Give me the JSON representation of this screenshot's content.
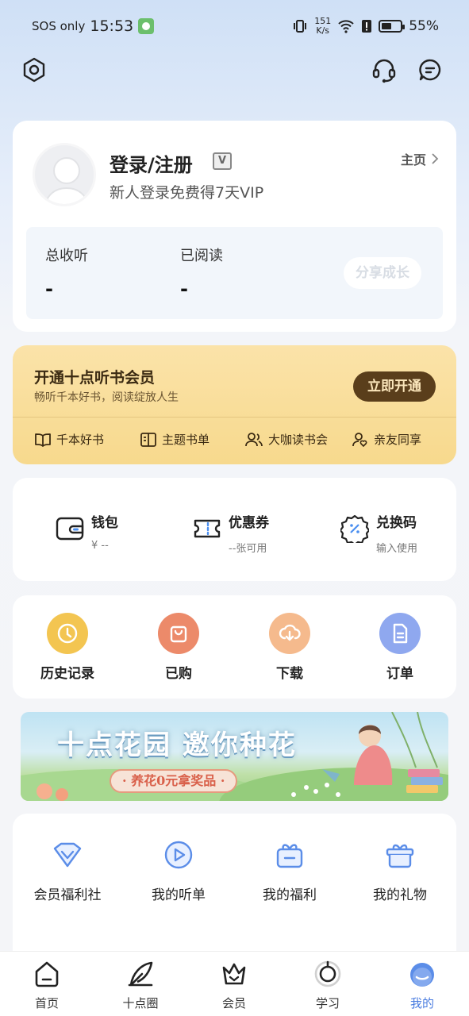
{
  "status_bar": {
    "carrier": "SOS only",
    "time": "15:53",
    "net_speed_value": "151",
    "net_speed_unit": "K/s",
    "battery": "55%"
  },
  "top_bar": {
    "icons": [
      "settings-icon",
      "customer-service-icon",
      "message-icon"
    ]
  },
  "profile": {
    "login_label": "登录/注册",
    "vip_badge": "V",
    "subtitle": "新人登录免费得7天VIP",
    "home_link": "主页",
    "stats": [
      {
        "label": "总收听",
        "value": "-"
      },
      {
        "label": "已阅读",
        "value": "-"
      }
    ],
    "share_button": "分享成长"
  },
  "vip_card": {
    "title": "开通十点听书会员",
    "subtitle": "畅听千本好书，阅读绽放人生",
    "button": "立即开通",
    "features": [
      "千本好书",
      "主题书单",
      "大咖读书会",
      "亲友同享"
    ]
  },
  "wallet": [
    {
      "title": "钱包",
      "sub": "¥ --",
      "icon": "wallet-icon"
    },
    {
      "title": "优惠券",
      "sub": "--张可用",
      "icon": "coupon-icon"
    },
    {
      "title": "兑换码",
      "sub": "输入使用",
      "icon": "redeem-code-icon"
    }
  ],
  "quick_actions": [
    {
      "label": "历史记录",
      "icon": "clock-icon",
      "color": "#f2c450"
    },
    {
      "label": "已购",
      "icon": "bag-icon",
      "color": "#ec8a6a"
    },
    {
      "label": "下载",
      "icon": "download-icon",
      "color": "#f4b98c"
    },
    {
      "label": "订单",
      "icon": "order-icon",
      "color": "#8fa8ef"
    }
  ],
  "banner": {
    "title": "十点花园 邀你种花",
    "pill": "· 养花0元拿奖品 ·"
  },
  "services": [
    {
      "label": "会员福利社",
      "icon": "diamond-icon"
    },
    {
      "label": "我的听单",
      "icon": "play-circle-icon"
    },
    {
      "label": "我的福利",
      "icon": "gift-box-icon"
    },
    {
      "label": "我的礼物",
      "icon": "present-basket-icon"
    }
  ],
  "bottom_nav": [
    {
      "label": "首页",
      "icon": "home-icon",
      "active": false
    },
    {
      "label": "十点圈",
      "icon": "feather-icon",
      "active": false
    },
    {
      "label": "会员",
      "icon": "crown-icon",
      "active": false
    },
    {
      "label": "学习",
      "icon": "study-icon",
      "active": false
    },
    {
      "label": "我的",
      "icon": "profile-icon",
      "active": true
    }
  ],
  "colors": {
    "accent": "#4b7de0",
    "vip_button": "#5a3e1b",
    "vip_bg": "#f8dc94"
  }
}
